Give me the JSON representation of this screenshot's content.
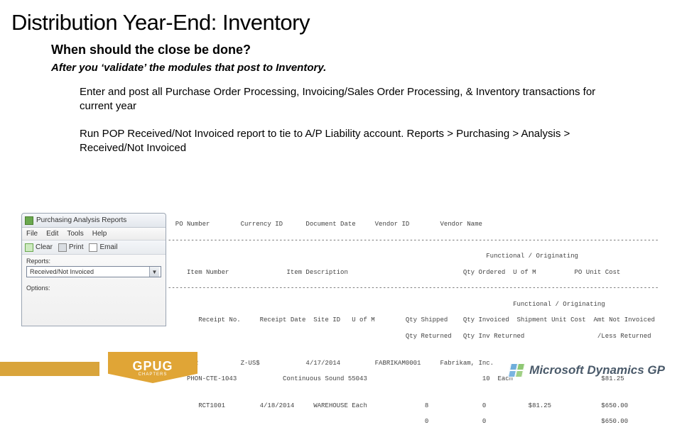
{
  "title": "Distribution Year-End: Inventory",
  "heading": "When should the close be done?",
  "sub": "After you ‘validate’ the modules that post to Inventory.",
  "bullet1": "Enter and post all Purchase Order Processing, Invoicing/Sales Order Processing, & Inventory transactions for current year",
  "bullet2": "Run POP Received/Not Invoiced report to tie to A/P Liability account. Reports > Purchasing > Analysis > Received/Not Invoiced",
  "window": {
    "title": "Purchasing Analysis Reports",
    "menu": {
      "file": "File",
      "edit": "Edit",
      "tools": "Tools",
      "help": "Help"
    },
    "toolbar": {
      "clear": "Clear",
      "print": "Print",
      "email": "Email"
    },
    "reports_label": "Reports:",
    "reports_value": "Received/Not Invoiced",
    "options_label": "Options:"
  },
  "report": {
    "hdr1": "  PO Number        Currency ID      Document Date     Vendor ID        Vendor Name",
    "hdr2": "                                                                                   Functional / Originating",
    "hdr3": "     Item Number               Item Description                              Qty Ordered  U of M          PO Unit Cost",
    "hdr4": "                                                                                          Functional / Originating",
    "hdr5": "        Receipt No.     Receipt Date  Site ID   U of M        Qty Shipped    Qty Invoiced  Shipment Unit Cost  Amt Not Invoiced",
    "hdr6": "                                                              Qty Returned   Qty Inv Returned                   /Less Returned",
    "row1": "  PO1002           Z-US$            4/17/2014         FABRIKAM0001     Fabrikam, Inc.",
    "row2": "     PHON-CTE-1043            Continuous Sound 55043                              10  Each                       $81.25",
    "row3": "        RCT1001         4/18/2014     WAREHOUSE Each               8              0           $81.25             $650.00",
    "row4": "                                                                   0              0                              $650.00"
  },
  "footer": {
    "gpug": "GPUG",
    "gpug_sub": "CHAPTERS",
    "ms": "Microsoft Dynamics GP"
  }
}
